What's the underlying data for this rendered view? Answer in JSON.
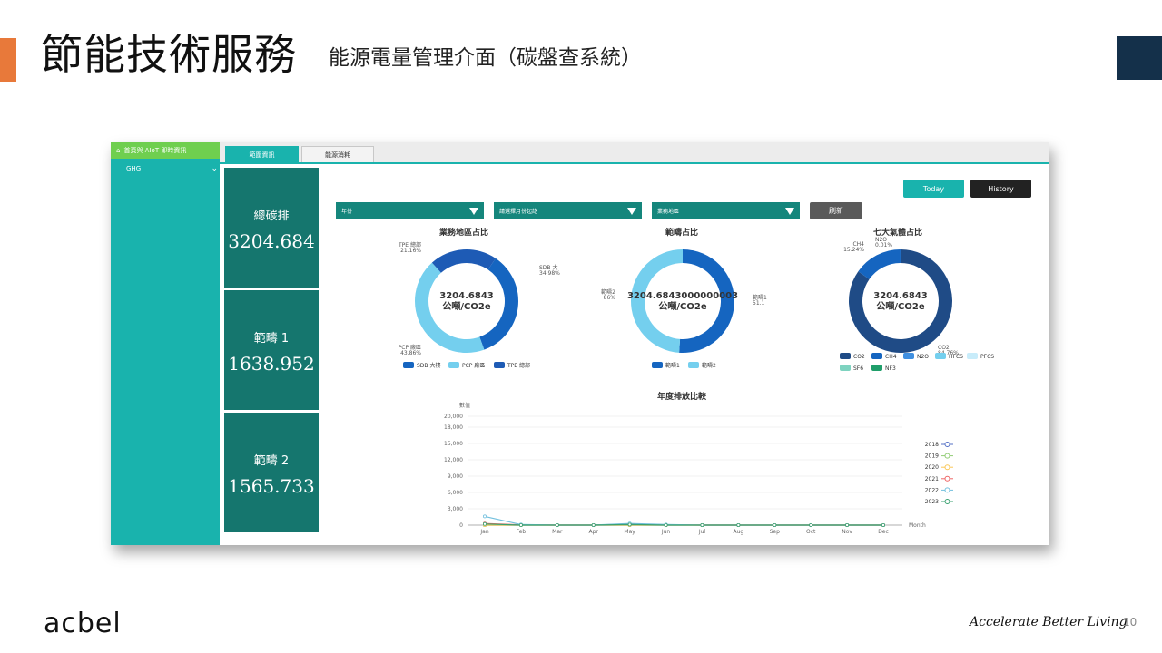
{
  "slide": {
    "title": "節能技術服務",
    "subtitle": "能源電量管理介面（碳盤查系統）",
    "logo": "acbel",
    "tagline": "Accelerate Better Living",
    "page_number": "10",
    "colors": {
      "orange": "#e8793a",
      "navy": "#14304a",
      "teal": "#19b3ad",
      "dark_teal": "#15766e",
      "green": "#6fcf4f"
    }
  },
  "app": {
    "sidebar": {
      "header_label": "首頁與 AIoT 即時資訊",
      "items": [
        {
          "label": "GHG"
        }
      ]
    },
    "tabs": [
      {
        "label": "範圍資訊",
        "active": true
      },
      {
        "label": "能源消耗",
        "active": false
      }
    ],
    "stats": [
      {
        "label": "總碳排",
        "value": "3204.684"
      },
      {
        "label": "範疇 1",
        "value": "1638.952"
      },
      {
        "label": "範疇 2",
        "value": "1565.733"
      }
    ],
    "buttons": {
      "today": "Today",
      "history": "History",
      "refresh": "刷新"
    },
    "filters": [
      {
        "label": "年份"
      },
      {
        "label": "請選擇月份起訖"
      },
      {
        "label": "業務地區"
      }
    ]
  },
  "chart_data": [
    {
      "type": "pie",
      "title": "業務地區占比",
      "center_value": "3204.6843",
      "center_unit": "公噸/CO2e",
      "slices": [
        {
          "name": "SDB 大樓",
          "short": "SDB 大",
          "value": 34.98,
          "label": "34.98%",
          "color": "#1565c0"
        },
        {
          "name": "PCP 廠區",
          "short": "PCP 廠區",
          "value": 43.86,
          "label": "43.86%",
          "color": "#74cfee"
        },
        {
          "name": "TPE 總部",
          "short": "TPE 總部",
          "value": 21.16,
          "label": "21.16%",
          "color": "#1e5bb5"
        }
      ]
    },
    {
      "type": "pie",
      "title": "範疇占比",
      "center_value": "3204.6843000000003",
      "center_unit": "公噸/CO2e",
      "slices": [
        {
          "name": "範疇1",
          "value": 51.1,
          "label": "51.1",
          "color": "#1565c0"
        },
        {
          "name": "範疇2",
          "value": 48.9,
          "label": "86%",
          "color": "#74cfee"
        }
      ]
    },
    {
      "type": "pie",
      "title": "七大氣體占比",
      "center_value": "3204.6843",
      "center_unit": "公噸/CO2e",
      "slices": [
        {
          "name": "CO2",
          "value": 84.76,
          "label": "84.76%",
          "color": "#1f4b86"
        },
        {
          "name": "CH4",
          "value": 15.24,
          "label": "15.24%",
          "color": "#1565c0"
        },
        {
          "name": "N2O",
          "value": 0.01,
          "label": "0.01%",
          "color": "#3f8fe0"
        },
        {
          "name": "HFCS",
          "value": 0,
          "label": "",
          "color": "#74cfee"
        },
        {
          "name": "PFCS",
          "value": 0,
          "label": "",
          "color": "#c8ecfa"
        },
        {
          "name": "SF6",
          "value": 0,
          "label": "",
          "color": "#7ed3c0"
        },
        {
          "name": "NF3",
          "value": 0,
          "label": "",
          "color": "#1f9e6a"
        }
      ]
    },
    {
      "type": "line",
      "title": "年度排放比較",
      "ylabel": "數值",
      "xlabel": "Month",
      "categories": [
        "Jan",
        "Feb",
        "Mar",
        "Apr",
        "May",
        "Jun",
        "Jul",
        "Aug",
        "Sep",
        "Oct",
        "Nov",
        "Dec"
      ],
      "yticks": [
        0,
        3000,
        6000,
        9000,
        12000,
        15000,
        18000,
        20000
      ],
      "ytick_labels": [
        "0",
        "3,000",
        "6,000",
        "9,000",
        "12,000",
        "15,000",
        "18,000",
        "20,000"
      ],
      "ylim": [
        0,
        20000
      ],
      "series": [
        {
          "name": "2018",
          "color": "#5470c6",
          "values": [
            0,
            0,
            0,
            0,
            0,
            0,
            0,
            0,
            0,
            0,
            0,
            0
          ]
        },
        {
          "name": "2019",
          "color": "#91cc75",
          "values": [
            0,
            0,
            0,
            0,
            0,
            0,
            0,
            0,
            0,
            0,
            0,
            0
          ]
        },
        {
          "name": "2020",
          "color": "#fac858",
          "values": [
            0,
            0,
            0,
            0,
            0,
            0,
            0,
            0,
            0,
            0,
            0,
            0
          ]
        },
        {
          "name": "2021",
          "color": "#ee6666",
          "values": [
            300,
            50,
            0,
            0,
            200,
            50,
            0,
            0,
            0,
            0,
            0,
            0
          ]
        },
        {
          "name": "2022",
          "color": "#73c0de",
          "values": [
            1600,
            100,
            0,
            0,
            300,
            100,
            0,
            0,
            0,
            0,
            0,
            0
          ]
        },
        {
          "name": "2023",
          "color": "#3ba272",
          "values": [
            200,
            0,
            0,
            0,
            100,
            0,
            0,
            0,
            0,
            0,
            0,
            0
          ]
        }
      ]
    }
  ]
}
